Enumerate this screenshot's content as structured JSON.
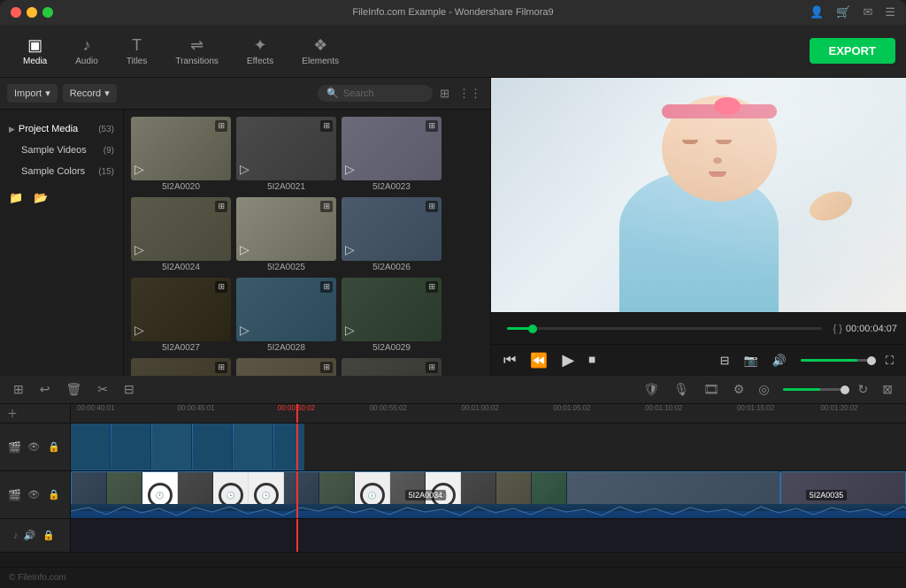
{
  "window": {
    "title": "FileInfo.com Example - Wondershare Filmora9"
  },
  "nav": {
    "items": [
      {
        "id": "media",
        "label": "Media",
        "icon": "◫",
        "active": true
      },
      {
        "id": "audio",
        "label": "Audio",
        "icon": "♪"
      },
      {
        "id": "titles",
        "label": "Titles",
        "icon": "T"
      },
      {
        "id": "transitions",
        "label": "Transitions",
        "icon": "⇌"
      },
      {
        "id": "effects",
        "label": "Effects",
        "icon": "✦"
      },
      {
        "id": "elements",
        "label": "Elements",
        "icon": "❖"
      }
    ],
    "export_label": "EXPORT"
  },
  "left_toolbar": {
    "import_label": "Import",
    "record_label": "Record",
    "search_placeholder": "Search"
  },
  "sidebar": {
    "sections": [
      {
        "label": "Project Media",
        "count": "(53)",
        "active": true,
        "arrow": "▼"
      },
      {
        "label": "Sample Videos",
        "count": "(9)"
      },
      {
        "label": "Sample Colors",
        "count": "(15)"
      }
    ]
  },
  "media_grid": {
    "items": [
      {
        "id": "5I2A0020",
        "label": "5I2A0020",
        "thumb_class": "thumb-1"
      },
      {
        "id": "5I2A0021",
        "label": "5I2A0021",
        "thumb_class": "thumb-2"
      },
      {
        "id": "5I2A0023",
        "label": "5I2A0023",
        "thumb_class": "thumb-3"
      },
      {
        "id": "5I2A0024",
        "label": "5I2A0024",
        "thumb_class": "thumb-4"
      },
      {
        "id": "5I2A0025",
        "label": "5I2A0025",
        "thumb_class": "thumb-5"
      },
      {
        "id": "5I2A0026",
        "label": "5I2A0026",
        "thumb_class": "thumb-6"
      },
      {
        "id": "5I2A0027",
        "label": "5I2A0027",
        "thumb_class": "thumb-7"
      },
      {
        "id": "5I2A0028",
        "label": "5I2A0028",
        "thumb_class": "thumb-8"
      },
      {
        "id": "5I2A0029",
        "label": "5I2A0029",
        "thumb_class": "thumb-9"
      },
      {
        "id": "partial1",
        "label": "",
        "thumb_class": "thumb-partial"
      },
      {
        "id": "partial2",
        "label": "",
        "thumb_class": "thumb-1"
      },
      {
        "id": "partial3",
        "label": "",
        "thumb_class": "thumb-2"
      }
    ]
  },
  "preview": {
    "time": "00:00:04:07",
    "time_bracket_open": "{",
    "time_bracket_close": "}",
    "progress_percent": 8
  },
  "timeline": {
    "ruler_labels": [
      {
        "label": "00:00:40:01",
        "pos_pct": 3
      },
      {
        "label": "00:00:45:01",
        "pos_pct": 15
      },
      {
        "label": "00:00:50:02",
        "pos_pct": 27
      },
      {
        "label": "00:00:55:02",
        "pos_pct": 38
      },
      {
        "label": "00:01:00:02",
        "pos_pct": 49
      },
      {
        "label": "00:01:05:02",
        "pos_pct": 60
      },
      {
        "label": "00:01:10:02",
        "pos_pct": 71
      },
      {
        "label": "00:01:15:02",
        "pos_pct": 82
      },
      {
        "label": "00:01:20:02",
        "pos_pct": 92
      }
    ],
    "playhead_pos_pct": 27,
    "clips": [
      {
        "track": 0,
        "label": "",
        "left_pct": 0,
        "width_pct": 28,
        "type": "video"
      },
      {
        "track": 1,
        "label": "5I2A0034",
        "left_pct": 0,
        "width_pct": 85,
        "type": "video"
      },
      {
        "track": 1,
        "label": "5I2A0035",
        "left_pct": 85,
        "width_pct": 15,
        "type": "video"
      }
    ]
  },
  "footer": {
    "copyright": "© FileInfo.com"
  },
  "colors": {
    "accent": "#00c853",
    "playhead": "#ff3333",
    "clip_video": "#2a6fa8",
    "clip_audio": "#1a4a6a"
  }
}
